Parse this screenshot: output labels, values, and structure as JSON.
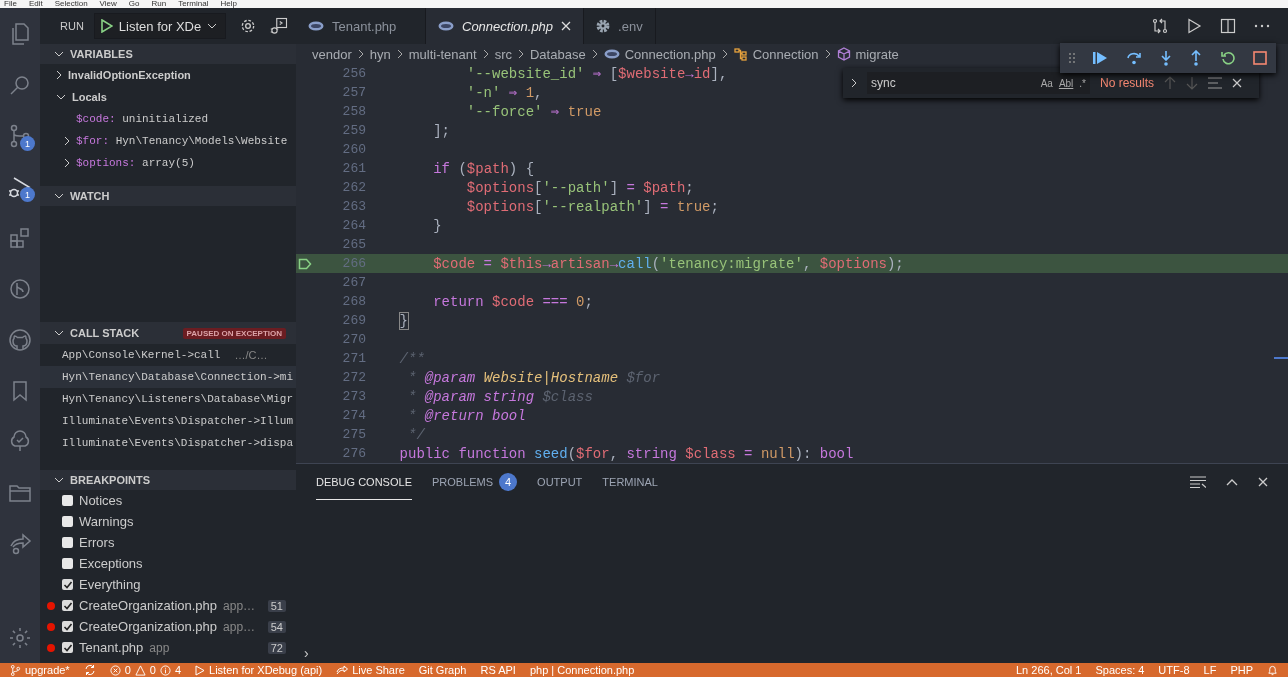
{
  "menu": [
    "File",
    "Edit",
    "Selection",
    "View",
    "Go",
    "Run",
    "Terminal",
    "Help"
  ],
  "activity_bar": [
    {
      "kind": "files",
      "selected": false
    },
    {
      "kind": "search",
      "selected": false
    },
    {
      "kind": "source-control",
      "selected": false,
      "badge": "1"
    },
    {
      "kind": "debug",
      "selected": true,
      "badge": "1"
    },
    {
      "kind": "extensions",
      "selected": false
    },
    {
      "kind": "git-graph",
      "selected": false
    },
    {
      "kind": "github",
      "selected": false
    },
    {
      "kind": "bookmark",
      "selected": false
    },
    {
      "kind": "tree",
      "selected": false
    },
    {
      "kind": "folder",
      "selected": false
    },
    {
      "kind": "share",
      "selected": false
    }
  ],
  "run": {
    "label": "RUN",
    "config": "Listen for XDe"
  },
  "variables": {
    "title": "VARIABLES",
    "items": [
      {
        "label": "InvalidOptionException",
        "expanded": false
      },
      {
        "label": "Locals",
        "expanded": true,
        "children": [
          {
            "name": "$code:",
            "value": "uninitialized",
            "expandable": false
          },
          {
            "name": "$for:",
            "value": "Hyn\\Tenancy\\Models\\Website",
            "expandable": true
          },
          {
            "name": "$options:",
            "value": "array(5)",
            "expandable": true
          }
        ]
      }
    ]
  },
  "watch": {
    "title": "WATCH"
  },
  "call_stack": {
    "title": "CALL STACK",
    "badge": "PAUSED ON EXCEPTION",
    "frames": [
      {
        "name": "App\\Console\\Kernel->call",
        "source": "…/C…",
        "selected": false
      },
      {
        "name": "Hyn\\Tenancy\\Database\\Connection->mi",
        "selected": true
      },
      {
        "name": "Hyn\\Tenancy\\Listeners\\Database\\Migr",
        "selected": false
      },
      {
        "name": "Illuminate\\Events\\Dispatcher->Illum",
        "selected": false
      },
      {
        "name": "Illuminate\\Events\\Dispatcher->dispa",
        "selected": false
      }
    ]
  },
  "breakpoints": {
    "title": "BREAKPOINTS",
    "items": [
      {
        "kind": "exception",
        "label": "Notices",
        "checked": false
      },
      {
        "kind": "exception",
        "label": "Warnings",
        "checked": false
      },
      {
        "kind": "exception",
        "label": "Errors",
        "checked": false
      },
      {
        "kind": "exception",
        "label": "Exceptions",
        "checked": false
      },
      {
        "kind": "exception",
        "label": "Everything",
        "checked": true
      },
      {
        "kind": "file",
        "label": "CreateOrganization.php",
        "path": "app…",
        "line": "51",
        "checked": true
      },
      {
        "kind": "file",
        "label": "CreateOrganization.php",
        "path": "app…",
        "line": "54",
        "checked": true
      },
      {
        "kind": "file",
        "label": "Tenant.php",
        "path": "app",
        "line": "72",
        "checked": true
      }
    ]
  },
  "tabs": [
    {
      "kind": "php",
      "label": "Tenant.php",
      "selected": false
    },
    {
      "kind": "php",
      "label": "Connection.php",
      "selected": true
    },
    {
      "kind": "settings",
      "label": ".env",
      "selected": false
    }
  ],
  "breadcrumb": [
    {
      "kind": "folder",
      "label": "vendor"
    },
    {
      "kind": "folder",
      "label": "hyn"
    },
    {
      "kind": "folder",
      "label": "multi-tenant"
    },
    {
      "kind": "folder",
      "label": "src"
    },
    {
      "kind": "folder",
      "label": "Database"
    },
    {
      "kind": "php",
      "label": "Connection.php"
    },
    {
      "kind": "class",
      "label": "Connection"
    },
    {
      "kind": "method",
      "label": "migrate"
    }
  ],
  "find": {
    "value": "sync",
    "options": [
      "Aa",
      "Abl",
      ".*"
    ],
    "result": "No results"
  },
  "code": [
    {
      "number": "256",
      "current": false,
      "tokens": [
        {
          "kind": "string",
          "text": "            '--website_id'"
        },
        {
          "kind": "op",
          "text": " ⇒ "
        },
        {
          "kind": "plain",
          "text": "["
        },
        {
          "kind": "var",
          "text": "$website"
        },
        {
          "kind": "op",
          "text": "→"
        },
        {
          "kind": "var",
          "text": "id"
        },
        {
          "kind": "plain",
          "text": "],"
        }
      ]
    },
    {
      "number": "257",
      "current": false,
      "tokens": [
        {
          "kind": "string",
          "text": "            '-n'"
        },
        {
          "kind": "op",
          "text": " ⇒ "
        },
        {
          "kind": "num",
          "text": "1"
        },
        {
          "kind": "plain",
          "text": ","
        }
      ]
    },
    {
      "number": "258",
      "current": false,
      "tokens": [
        {
          "kind": "string",
          "text": "            '--force'"
        },
        {
          "kind": "op",
          "text": " ⇒ "
        },
        {
          "kind": "num",
          "text": "true"
        }
      ]
    },
    {
      "number": "259",
      "current": false,
      "tokens": [
        {
          "kind": "plain",
          "text": "        ];"
        }
      ]
    },
    {
      "number": "260",
      "current": false
    },
    {
      "number": "261",
      "current": false,
      "tokens": [
        {
          "kind": "kw",
          "text": "        if"
        },
        {
          "kind": "plain",
          "text": " ("
        },
        {
          "kind": "var",
          "text": "$path"
        },
        {
          "kind": "plain",
          "text": ") {"
        }
      ]
    },
    {
      "number": "262",
      "current": false,
      "tokens": [
        {
          "kind": "var",
          "text": "            $options"
        },
        {
          "kind": "plain",
          "text": "["
        },
        {
          "kind": "string",
          "text": "'--path'"
        },
        {
          "kind": "plain",
          "text": "] "
        },
        {
          "kind": "op",
          "text": "= "
        },
        {
          "kind": "var",
          "text": "$path"
        },
        {
          "kind": "plain",
          "text": ";"
        }
      ]
    },
    {
      "number": "263",
      "current": false,
      "tokens": [
        {
          "kind": "var",
          "text": "            $options"
        },
        {
          "kind": "plain",
          "text": "["
        },
        {
          "kind": "string",
          "text": "'--realpath'"
        },
        {
          "kind": "plain",
          "text": "] "
        },
        {
          "kind": "op",
          "text": "= "
        },
        {
          "kind": "num",
          "text": "true"
        },
        {
          "kind": "plain",
          "text": ";"
        }
      ]
    },
    {
      "number": "264",
      "current": false,
      "tokens": [
        {
          "kind": "plain",
          "text": "        }"
        }
      ]
    },
    {
      "number": "265",
      "current": false
    },
    {
      "number": "266",
      "current": true,
      "tokens": [
        {
          "kind": "var",
          "text": "        $code"
        },
        {
          "kind": "op",
          "text": " = "
        },
        {
          "kind": "var",
          "text": "$this"
        },
        {
          "kind": "op",
          "text": "→"
        },
        {
          "kind": "var",
          "text": "artisan"
        },
        {
          "kind": "op",
          "text": "→"
        },
        {
          "kind": "fn",
          "text": "call"
        },
        {
          "kind": "plain",
          "text": "("
        },
        {
          "kind": "string",
          "text": "'tenancy:migrate'"
        },
        {
          "kind": "plain",
          "text": ", "
        },
        {
          "kind": "var",
          "text": "$options"
        },
        {
          "kind": "plain",
          "text": ");"
        }
      ]
    },
    {
      "number": "267",
      "current": false
    },
    {
      "number": "268",
      "current": false,
      "tokens": [
        {
          "kind": "kw",
          "text": "        return "
        },
        {
          "kind": "var",
          "text": "$code"
        },
        {
          "kind": "op",
          "text": " === "
        },
        {
          "kind": "num",
          "text": "0"
        },
        {
          "kind": "plain",
          "text": ";"
        }
      ]
    },
    {
      "number": "269",
      "current": false,
      "tokens": [
        {
          "kind": "bracket",
          "text": "    }"
        }
      ]
    },
    {
      "number": "270",
      "current": false
    },
    {
      "number": "271",
      "current": false,
      "tokens": [
        {
          "kind": "comment",
          "text": "    /**"
        }
      ]
    },
    {
      "number": "272",
      "current": false,
      "tokens": [
        {
          "kind": "comment",
          "text": "     * "
        },
        {
          "kind": "doctag",
          "text": "@param"
        },
        {
          "kind": "doctype",
          "text": " Website|Hostname"
        },
        {
          "kind": "comment",
          "text": " $for"
        }
      ]
    },
    {
      "number": "273",
      "current": false,
      "tokens": [
        {
          "kind": "comment",
          "text": "     * "
        },
        {
          "kind": "doctag",
          "text": "@param string"
        },
        {
          "kind": "comment",
          "text": " $class"
        }
      ]
    },
    {
      "number": "274",
      "current": false,
      "tokens": [
        {
          "kind": "comment",
          "text": "     * "
        },
        {
          "kind": "doctag",
          "text": "@return bool"
        }
      ]
    },
    {
      "number": "275",
      "current": false,
      "tokens": [
        {
          "kind": "comment",
          "text": "     */"
        }
      ]
    },
    {
      "number": "276",
      "current": false,
      "tokens": [
        {
          "kind": "kw",
          "text": "    public function "
        },
        {
          "kind": "fn",
          "text": "seed"
        },
        {
          "kind": "plain",
          "text": "("
        },
        {
          "kind": "var",
          "text": "$for"
        },
        {
          "kind": "plain",
          "text": ", "
        },
        {
          "kind": "kw",
          "text": "string"
        },
        {
          "kind": "var",
          "text": " $class"
        },
        {
          "kind": "op",
          "text": " = "
        },
        {
          "kind": "num",
          "text": "null"
        },
        {
          "kind": "plain",
          "text": "): "
        },
        {
          "kind": "kw",
          "text": "bool"
        }
      ]
    }
  ],
  "panel": {
    "tabs": [
      {
        "label": "DEBUG CONSOLE",
        "selected": true
      },
      {
        "label": "PROBLEMS",
        "selected": false,
        "badge": "4"
      },
      {
        "label": "OUTPUT",
        "selected": false
      },
      {
        "label": "TERMINAL",
        "selected": false
      }
    ],
    "prompt": "›"
  },
  "status_bar": {
    "left": [
      {
        "kind": "branch",
        "label": "upgrade*"
      },
      {
        "kind": "sync"
      },
      {
        "kind": "problems",
        "errors": "0",
        "warnings": "0",
        "infos": "4"
      },
      {
        "kind": "play",
        "label": "Listen for XDebug (api)"
      },
      {
        "kind": "share",
        "label": "Live Share"
      },
      {
        "kind": "text",
        "label": "Git Graph"
      },
      {
        "kind": "text",
        "label": "RS API"
      },
      {
        "kind": "text",
        "label": "php | Connection.php"
      }
    ],
    "right": [
      "Ln 266, Col 1",
      "Spaces: 4",
      "UTF-8",
      "LF",
      "PHP"
    ]
  }
}
